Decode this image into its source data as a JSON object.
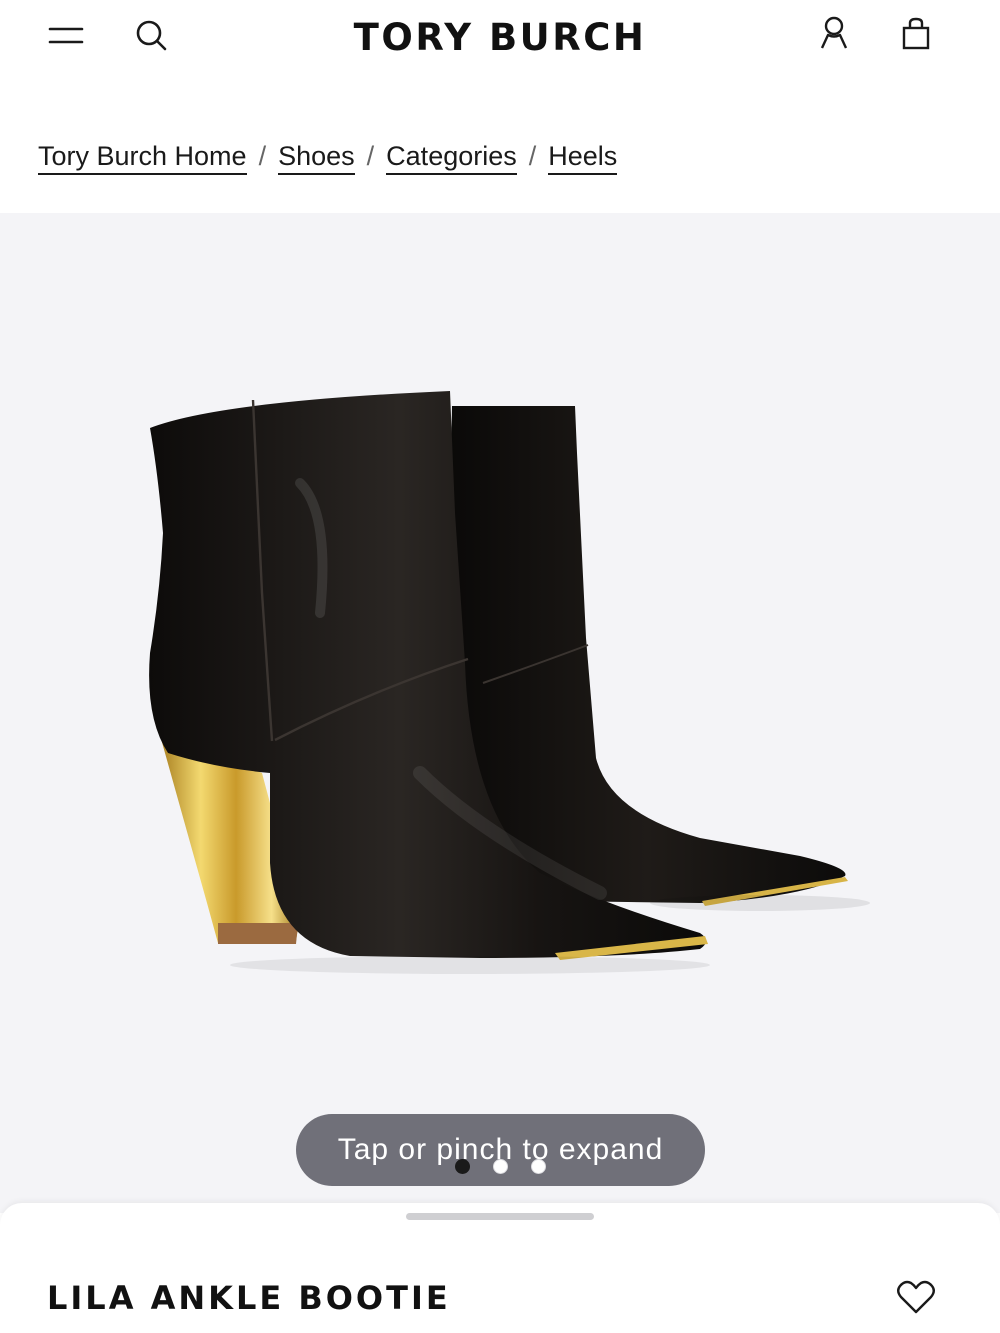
{
  "header": {
    "brand": "TORY BURCH",
    "icons": [
      "menu-icon",
      "search-icon",
      "account-icon",
      "shopping-bag-icon"
    ]
  },
  "breadcrumb": {
    "items": [
      "Tory Burch Home",
      "Shoes",
      "Categories",
      "Heels"
    ],
    "separator": "/"
  },
  "gallery": {
    "expand_hint": "Tap or pinch to expand",
    "page_count": 3,
    "active_page": 1,
    "background_color": "#f4f4f7"
  },
  "product": {
    "name": "LILA ANKLE BOOTIE",
    "wishlist_icon": "heart-icon"
  },
  "colors": {
    "text": "#1a1a1a",
    "pill": "#64646e",
    "dot_active": "#1a1a1a",
    "dot_inactive": "#ffffff",
    "leather": "#141210",
    "gold_heel": "#d8b23a"
  }
}
